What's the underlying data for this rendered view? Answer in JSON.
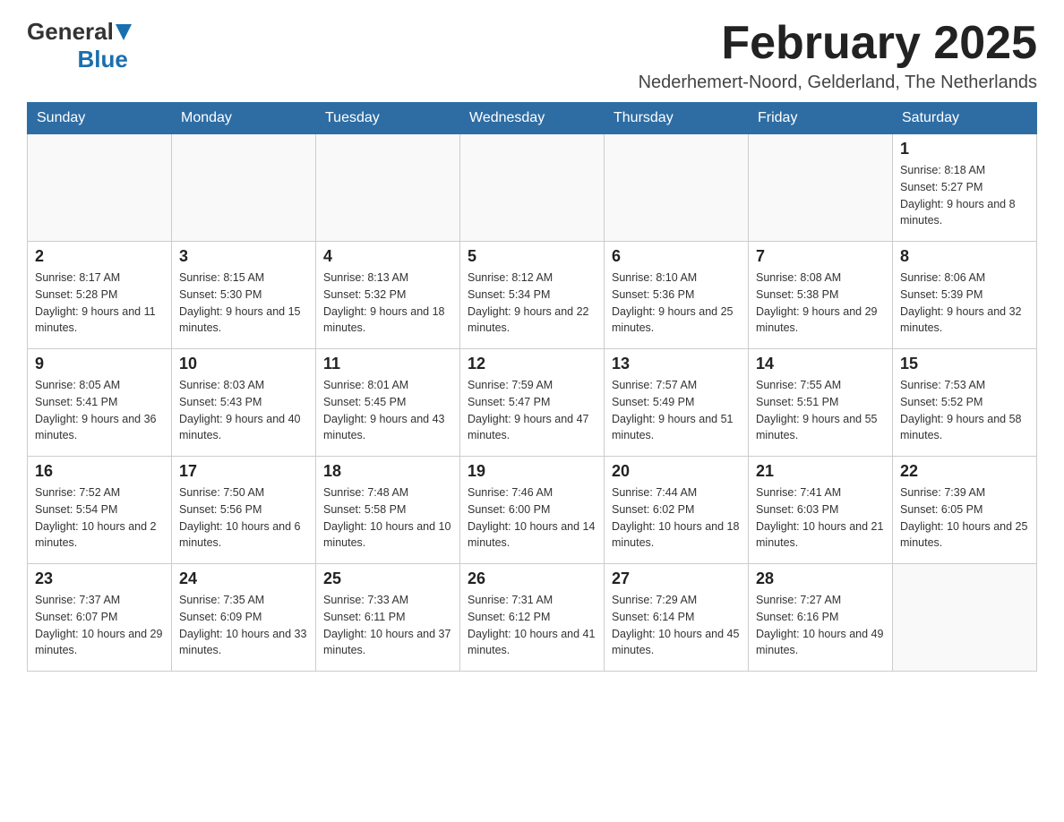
{
  "logo": {
    "general": "General",
    "blue": "Blue"
  },
  "title": "February 2025",
  "subtitle": "Nederhemert-Noord, Gelderland, The Netherlands",
  "days_of_week": [
    "Sunday",
    "Monday",
    "Tuesday",
    "Wednesday",
    "Thursday",
    "Friday",
    "Saturday"
  ],
  "weeks": [
    [
      {
        "day": "",
        "info": ""
      },
      {
        "day": "",
        "info": ""
      },
      {
        "day": "",
        "info": ""
      },
      {
        "day": "",
        "info": ""
      },
      {
        "day": "",
        "info": ""
      },
      {
        "day": "",
        "info": ""
      },
      {
        "day": "1",
        "info": "Sunrise: 8:18 AM\nSunset: 5:27 PM\nDaylight: 9 hours and 8 minutes."
      }
    ],
    [
      {
        "day": "2",
        "info": "Sunrise: 8:17 AM\nSunset: 5:28 PM\nDaylight: 9 hours and 11 minutes."
      },
      {
        "day": "3",
        "info": "Sunrise: 8:15 AM\nSunset: 5:30 PM\nDaylight: 9 hours and 15 minutes."
      },
      {
        "day": "4",
        "info": "Sunrise: 8:13 AM\nSunset: 5:32 PM\nDaylight: 9 hours and 18 minutes."
      },
      {
        "day": "5",
        "info": "Sunrise: 8:12 AM\nSunset: 5:34 PM\nDaylight: 9 hours and 22 minutes."
      },
      {
        "day": "6",
        "info": "Sunrise: 8:10 AM\nSunset: 5:36 PM\nDaylight: 9 hours and 25 minutes."
      },
      {
        "day": "7",
        "info": "Sunrise: 8:08 AM\nSunset: 5:38 PM\nDaylight: 9 hours and 29 minutes."
      },
      {
        "day": "8",
        "info": "Sunrise: 8:06 AM\nSunset: 5:39 PM\nDaylight: 9 hours and 32 minutes."
      }
    ],
    [
      {
        "day": "9",
        "info": "Sunrise: 8:05 AM\nSunset: 5:41 PM\nDaylight: 9 hours and 36 minutes."
      },
      {
        "day": "10",
        "info": "Sunrise: 8:03 AM\nSunset: 5:43 PM\nDaylight: 9 hours and 40 minutes."
      },
      {
        "day": "11",
        "info": "Sunrise: 8:01 AM\nSunset: 5:45 PM\nDaylight: 9 hours and 43 minutes."
      },
      {
        "day": "12",
        "info": "Sunrise: 7:59 AM\nSunset: 5:47 PM\nDaylight: 9 hours and 47 minutes."
      },
      {
        "day": "13",
        "info": "Sunrise: 7:57 AM\nSunset: 5:49 PM\nDaylight: 9 hours and 51 minutes."
      },
      {
        "day": "14",
        "info": "Sunrise: 7:55 AM\nSunset: 5:51 PM\nDaylight: 9 hours and 55 minutes."
      },
      {
        "day": "15",
        "info": "Sunrise: 7:53 AM\nSunset: 5:52 PM\nDaylight: 9 hours and 58 minutes."
      }
    ],
    [
      {
        "day": "16",
        "info": "Sunrise: 7:52 AM\nSunset: 5:54 PM\nDaylight: 10 hours and 2 minutes."
      },
      {
        "day": "17",
        "info": "Sunrise: 7:50 AM\nSunset: 5:56 PM\nDaylight: 10 hours and 6 minutes."
      },
      {
        "day": "18",
        "info": "Sunrise: 7:48 AM\nSunset: 5:58 PM\nDaylight: 10 hours and 10 minutes."
      },
      {
        "day": "19",
        "info": "Sunrise: 7:46 AM\nSunset: 6:00 PM\nDaylight: 10 hours and 14 minutes."
      },
      {
        "day": "20",
        "info": "Sunrise: 7:44 AM\nSunset: 6:02 PM\nDaylight: 10 hours and 18 minutes."
      },
      {
        "day": "21",
        "info": "Sunrise: 7:41 AM\nSunset: 6:03 PM\nDaylight: 10 hours and 21 minutes."
      },
      {
        "day": "22",
        "info": "Sunrise: 7:39 AM\nSunset: 6:05 PM\nDaylight: 10 hours and 25 minutes."
      }
    ],
    [
      {
        "day": "23",
        "info": "Sunrise: 7:37 AM\nSunset: 6:07 PM\nDaylight: 10 hours and 29 minutes."
      },
      {
        "day": "24",
        "info": "Sunrise: 7:35 AM\nSunset: 6:09 PM\nDaylight: 10 hours and 33 minutes."
      },
      {
        "day": "25",
        "info": "Sunrise: 7:33 AM\nSunset: 6:11 PM\nDaylight: 10 hours and 37 minutes."
      },
      {
        "day": "26",
        "info": "Sunrise: 7:31 AM\nSunset: 6:12 PM\nDaylight: 10 hours and 41 minutes."
      },
      {
        "day": "27",
        "info": "Sunrise: 7:29 AM\nSunset: 6:14 PM\nDaylight: 10 hours and 45 minutes."
      },
      {
        "day": "28",
        "info": "Sunrise: 7:27 AM\nSunset: 6:16 PM\nDaylight: 10 hours and 49 minutes."
      },
      {
        "day": "",
        "info": ""
      }
    ]
  ]
}
